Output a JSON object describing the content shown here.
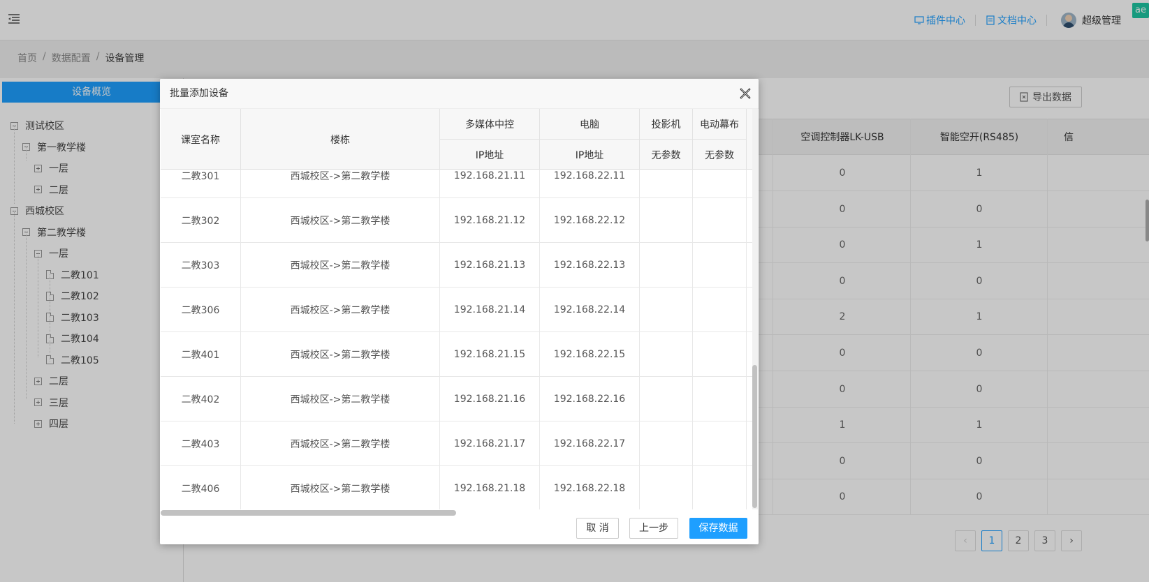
{
  "header": {
    "plugin_center": "插件中心",
    "doc_center": "文档中心",
    "username": "超级管理",
    "badge": "ae"
  },
  "breadcrumb": [
    "首页",
    "数据配置",
    "设备管理"
  ],
  "sidebar": {
    "title": "设备概览",
    "tree": [
      {
        "label": "测试校区",
        "level": 0,
        "icon": "minus-box-icon"
      },
      {
        "label": "第一教学楼",
        "level": 1,
        "icon": "minus-box-icon"
      },
      {
        "label": "一层",
        "level": 2,
        "icon": "plus-box-icon"
      },
      {
        "label": "二层",
        "level": 2,
        "icon": "plus-box-icon"
      },
      {
        "label": "西城校区",
        "level": 0,
        "icon": "minus-box-icon"
      },
      {
        "label": "第二教学楼",
        "level": 1,
        "icon": "minus-box-icon"
      },
      {
        "label": "一层",
        "level": 2,
        "icon": "minus-box-icon"
      },
      {
        "label": "二教101",
        "level": 3,
        "icon": "file-icon"
      },
      {
        "label": "二教102",
        "level": 3,
        "icon": "file-icon"
      },
      {
        "label": "二教103",
        "level": 3,
        "icon": "file-icon"
      },
      {
        "label": "二教104",
        "level": 3,
        "icon": "file-icon"
      },
      {
        "label": "二教105",
        "level": 3,
        "icon": "file-icon"
      },
      {
        "label": "二层",
        "level": 2,
        "icon": "plus-box-icon"
      },
      {
        "label": "三层",
        "level": 2,
        "icon": "plus-box-icon"
      },
      {
        "label": "四层",
        "level": 2,
        "icon": "plus-box-icon"
      }
    ]
  },
  "background_table": {
    "export_label": "导出数据",
    "headers": [
      "空调控制器LK-USB",
      "智能空开(RS485)",
      "信"
    ],
    "rows": [
      [
        "0",
        "1"
      ],
      [
        "0",
        "0"
      ],
      [
        "0",
        "1"
      ],
      [
        "0",
        "0"
      ],
      [
        "2",
        "1"
      ],
      [
        "0",
        "0"
      ],
      [
        "0",
        "0"
      ],
      [
        "1",
        "1"
      ],
      [
        "0",
        "0"
      ],
      [
        "0",
        "0"
      ]
    ],
    "pages": [
      "1",
      "2",
      "3"
    ],
    "current_page": "1"
  },
  "modal": {
    "title": "批量添加设备",
    "headers": {
      "room": "课室名称",
      "building": "楼栋",
      "media": "多媒体中控",
      "media_sub": "IP地址",
      "pc": "电脑",
      "pc_sub": "IP地址",
      "projector": "投影机",
      "projector_sub": "无参数",
      "screen": "电动幕布",
      "screen_sub": "无参数"
    },
    "rows": [
      {
        "room": "二教301",
        "building": "西城校区->第二教学楼",
        "media_ip": "192.168.21.11",
        "pc_ip": "192.168.22.11"
      },
      {
        "room": "二教302",
        "building": "西城校区->第二教学楼",
        "media_ip": "192.168.21.12",
        "pc_ip": "192.168.22.12"
      },
      {
        "room": "二教303",
        "building": "西城校区->第二教学楼",
        "media_ip": "192.168.21.13",
        "pc_ip": "192.168.22.13"
      },
      {
        "room": "二教306",
        "building": "西城校区->第二教学楼",
        "media_ip": "192.168.21.14",
        "pc_ip": "192.168.22.14"
      },
      {
        "room": "二教401",
        "building": "西城校区->第二教学楼",
        "media_ip": "192.168.21.15",
        "pc_ip": "192.168.22.15"
      },
      {
        "room": "二教402",
        "building": "西城校区->第二教学楼",
        "media_ip": "192.168.21.16",
        "pc_ip": "192.168.22.16"
      },
      {
        "room": "二教403",
        "building": "西城校区->第二教学楼",
        "media_ip": "192.168.21.17",
        "pc_ip": "192.168.22.17"
      },
      {
        "room": "二教406",
        "building": "西城校区->第二教学楼",
        "media_ip": "192.168.21.18",
        "pc_ip": "192.168.22.18"
      }
    ],
    "buttons": {
      "cancel": "取 消",
      "prev": "上一步",
      "save": "保存数据"
    }
  },
  "colors": {
    "primary": "#1e9fff",
    "badge": "#1ec6a2"
  }
}
